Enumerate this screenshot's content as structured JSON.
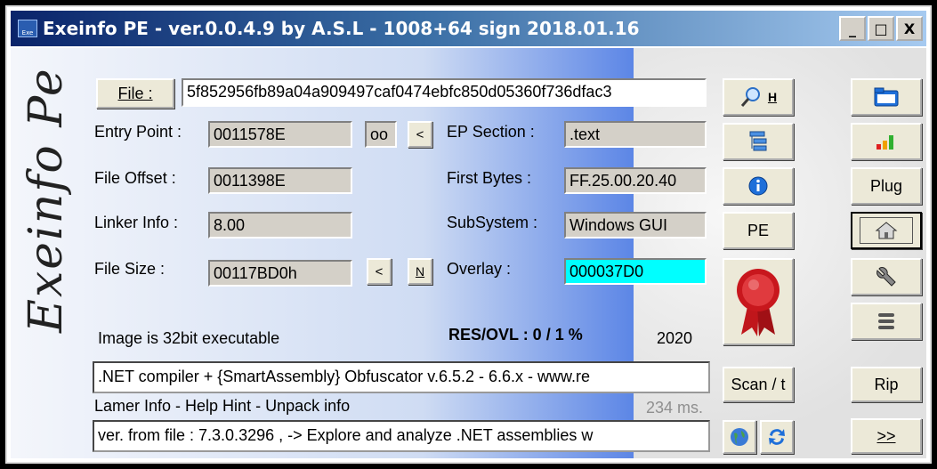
{
  "window": {
    "title": "Exeinfo PE - ver.0.0.4.9  by A.S.L -  1008+64 sign  2018.01.16",
    "icon_text": "Exe",
    "minimize": "_",
    "maximize": "□",
    "close": "X"
  },
  "logo": "Exeinfo Pe",
  "file": {
    "button": "File :",
    "hash": "5f852956fb89a04a909497caf0474ebfc850d05360f736dfac3"
  },
  "fields": {
    "entry_point_label": "Entry Point :",
    "entry_point": "0011578E",
    "oo_label": "oo",
    "lt_label": "<",
    "file_offset_label": "File Offset :",
    "file_offset": "0011398E",
    "linker_info_label": "Linker Info :",
    "linker_info": "8.00",
    "file_size_label": "File Size :",
    "file_size": "00117BD0h",
    "size_lt": "<",
    "size_n": "N",
    "ep_section_label": "EP Section :",
    "ep_section": ".text",
    "first_bytes_label": "First Bytes :",
    "first_bytes": "FF.25.00.20.40",
    "subsystem_label": "SubSystem :",
    "subsystem": "Windows GUI",
    "overlay_label": "Overlay :",
    "overlay": "000037D0"
  },
  "status": {
    "image_info": "Image is 32bit executable",
    "res_ovl": "RES/OVL : 0 / 1 %",
    "year": "2020"
  },
  "detection": ".NET compiler + {SmartAssembly} Obfuscator v.6.5.2 - 6.6.x - www.re",
  "lamer_info": "Lamer Info - Help Hint - Unpack info",
  "timing": "234 ms.",
  "hint": "ver. from file : 7.3.0.3296 , -> Explore and analyze .NET assemblies w",
  "mid_buttons": {
    "search_h": "H",
    "pe": "PE",
    "scan": "Scan / t"
  },
  "right_buttons": {
    "plug": "Plug",
    "rip": "Rip",
    "next": ">>"
  },
  "colors": {
    "overlay_bg": "#00ffff",
    "title_start": "#0a246a",
    "title_end": "#a6caf0"
  }
}
